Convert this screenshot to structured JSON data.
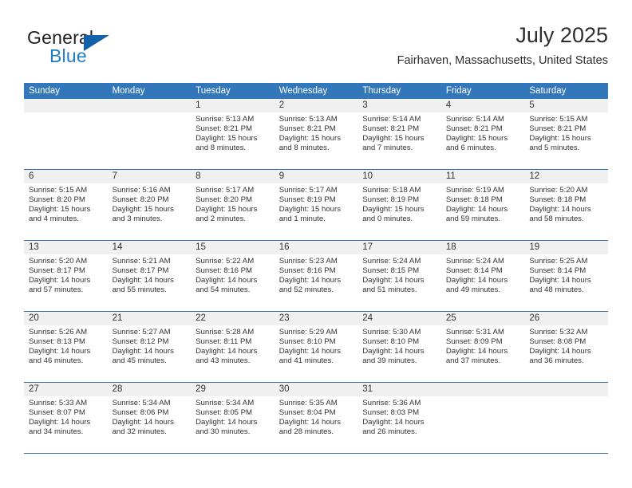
{
  "brand": {
    "name_part1": "General",
    "name_part2": "Blue",
    "triangle_color": "#1262ab",
    "blue_color": "#1f7dc4"
  },
  "header": {
    "title": "July 2025",
    "location": "Fairhaven, Massachusetts, United States"
  },
  "theme": {
    "header_blue": "#3177b9",
    "row_divider_blue": "#2e6fae",
    "daynum_band_gray": "#f0f0f0"
  },
  "weekday_headers": [
    "Sunday",
    "Monday",
    "Tuesday",
    "Wednesday",
    "Thursday",
    "Friday",
    "Saturday"
  ],
  "calendar": {
    "month": "July",
    "year": "2025",
    "weeks": [
      [
        {
          "day": "",
          "lines": []
        },
        {
          "day": "",
          "lines": []
        },
        {
          "day": "1",
          "lines": [
            "Sunrise: 5:13 AM",
            "Sunset: 8:21 PM",
            "Daylight: 15 hours",
            "and 8 minutes."
          ]
        },
        {
          "day": "2",
          "lines": [
            "Sunrise: 5:13 AM",
            "Sunset: 8:21 PM",
            "Daylight: 15 hours",
            "and 8 minutes."
          ]
        },
        {
          "day": "3",
          "lines": [
            "Sunrise: 5:14 AM",
            "Sunset: 8:21 PM",
            "Daylight: 15 hours",
            "and 7 minutes."
          ]
        },
        {
          "day": "4",
          "lines": [
            "Sunrise: 5:14 AM",
            "Sunset: 8:21 PM",
            "Daylight: 15 hours",
            "and 6 minutes."
          ]
        },
        {
          "day": "5",
          "lines": [
            "Sunrise: 5:15 AM",
            "Sunset: 8:21 PM",
            "Daylight: 15 hours",
            "and 5 minutes."
          ]
        }
      ],
      [
        {
          "day": "6",
          "lines": [
            "Sunrise: 5:15 AM",
            "Sunset: 8:20 PM",
            "Daylight: 15 hours",
            "and 4 minutes."
          ]
        },
        {
          "day": "7",
          "lines": [
            "Sunrise: 5:16 AM",
            "Sunset: 8:20 PM",
            "Daylight: 15 hours",
            "and 3 minutes."
          ]
        },
        {
          "day": "8",
          "lines": [
            "Sunrise: 5:17 AM",
            "Sunset: 8:20 PM",
            "Daylight: 15 hours",
            "and 2 minutes."
          ]
        },
        {
          "day": "9",
          "lines": [
            "Sunrise: 5:17 AM",
            "Sunset: 8:19 PM",
            "Daylight: 15 hours",
            "and 1 minute."
          ]
        },
        {
          "day": "10",
          "lines": [
            "Sunrise: 5:18 AM",
            "Sunset: 8:19 PM",
            "Daylight: 15 hours",
            "and 0 minutes."
          ]
        },
        {
          "day": "11",
          "lines": [
            "Sunrise: 5:19 AM",
            "Sunset: 8:18 PM",
            "Daylight: 14 hours",
            "and 59 minutes."
          ]
        },
        {
          "day": "12",
          "lines": [
            "Sunrise: 5:20 AM",
            "Sunset: 8:18 PM",
            "Daylight: 14 hours",
            "and 58 minutes."
          ]
        }
      ],
      [
        {
          "day": "13",
          "lines": [
            "Sunrise: 5:20 AM",
            "Sunset: 8:17 PM",
            "Daylight: 14 hours",
            "and 57 minutes."
          ]
        },
        {
          "day": "14",
          "lines": [
            "Sunrise: 5:21 AM",
            "Sunset: 8:17 PM",
            "Daylight: 14 hours",
            "and 55 minutes."
          ]
        },
        {
          "day": "15",
          "lines": [
            "Sunrise: 5:22 AM",
            "Sunset: 8:16 PM",
            "Daylight: 14 hours",
            "and 54 minutes."
          ]
        },
        {
          "day": "16",
          "lines": [
            "Sunrise: 5:23 AM",
            "Sunset: 8:16 PM",
            "Daylight: 14 hours",
            "and 52 minutes."
          ]
        },
        {
          "day": "17",
          "lines": [
            "Sunrise: 5:24 AM",
            "Sunset: 8:15 PM",
            "Daylight: 14 hours",
            "and 51 minutes."
          ]
        },
        {
          "day": "18",
          "lines": [
            "Sunrise: 5:24 AM",
            "Sunset: 8:14 PM",
            "Daylight: 14 hours",
            "and 49 minutes."
          ]
        },
        {
          "day": "19",
          "lines": [
            "Sunrise: 5:25 AM",
            "Sunset: 8:14 PM",
            "Daylight: 14 hours",
            "and 48 minutes."
          ]
        }
      ],
      [
        {
          "day": "20",
          "lines": [
            "Sunrise: 5:26 AM",
            "Sunset: 8:13 PM",
            "Daylight: 14 hours",
            "and 46 minutes."
          ]
        },
        {
          "day": "21",
          "lines": [
            "Sunrise: 5:27 AM",
            "Sunset: 8:12 PM",
            "Daylight: 14 hours",
            "and 45 minutes."
          ]
        },
        {
          "day": "22",
          "lines": [
            "Sunrise: 5:28 AM",
            "Sunset: 8:11 PM",
            "Daylight: 14 hours",
            "and 43 minutes."
          ]
        },
        {
          "day": "23",
          "lines": [
            "Sunrise: 5:29 AM",
            "Sunset: 8:10 PM",
            "Daylight: 14 hours",
            "and 41 minutes."
          ]
        },
        {
          "day": "24",
          "lines": [
            "Sunrise: 5:30 AM",
            "Sunset: 8:10 PM",
            "Daylight: 14 hours",
            "and 39 minutes."
          ]
        },
        {
          "day": "25",
          "lines": [
            "Sunrise: 5:31 AM",
            "Sunset: 8:09 PM",
            "Daylight: 14 hours",
            "and 37 minutes."
          ]
        },
        {
          "day": "26",
          "lines": [
            "Sunrise: 5:32 AM",
            "Sunset: 8:08 PM",
            "Daylight: 14 hours",
            "and 36 minutes."
          ]
        }
      ],
      [
        {
          "day": "27",
          "lines": [
            "Sunrise: 5:33 AM",
            "Sunset: 8:07 PM",
            "Daylight: 14 hours",
            "and 34 minutes."
          ]
        },
        {
          "day": "28",
          "lines": [
            "Sunrise: 5:34 AM",
            "Sunset: 8:06 PM",
            "Daylight: 14 hours",
            "and 32 minutes."
          ]
        },
        {
          "day": "29",
          "lines": [
            "Sunrise: 5:34 AM",
            "Sunset: 8:05 PM",
            "Daylight: 14 hours",
            "and 30 minutes."
          ]
        },
        {
          "day": "30",
          "lines": [
            "Sunrise: 5:35 AM",
            "Sunset: 8:04 PM",
            "Daylight: 14 hours",
            "and 28 minutes."
          ]
        },
        {
          "day": "31",
          "lines": [
            "Sunrise: 5:36 AM",
            "Sunset: 8:03 PM",
            "Daylight: 14 hours",
            "and 26 minutes."
          ]
        },
        {
          "day": "",
          "lines": []
        },
        {
          "day": "",
          "lines": []
        }
      ]
    ]
  }
}
